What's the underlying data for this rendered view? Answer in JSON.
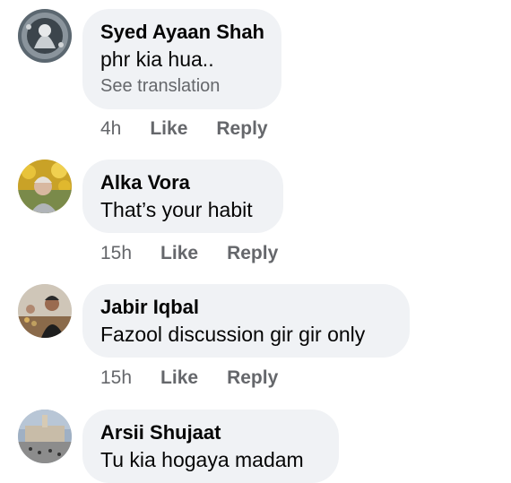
{
  "comments": [
    {
      "author": "Syed Ayaan Shah",
      "text": "phr kia hua..",
      "translation_link": "See translation",
      "time": "4h",
      "like": "Like",
      "reply": "Reply"
    },
    {
      "author": "Alka Vora",
      "text": "That’s your habit",
      "time": "15h",
      "like": "Like",
      "reply": "Reply"
    },
    {
      "author": "Jabir Iqbal",
      "text": "Fazool discussion gir gir only",
      "time": "15h",
      "like": "Like",
      "reply": "Reply"
    },
    {
      "author": "Arsii Shujaat",
      "text": "Tu kia hogaya madam"
    }
  ],
  "colors": {
    "bubble": "#f0f2f5",
    "meta_text": "#65676b",
    "primary_text": "#050505"
  }
}
